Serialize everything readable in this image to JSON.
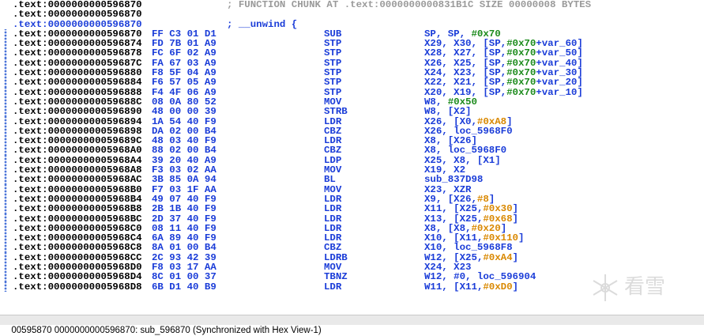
{
  "header_lines": [
    {
      "addr": ".text:0000000000596870",
      "comment": "; FUNCTION CHUNK AT .text:0000000000831B1C SIZE 00000008 BYTES"
    },
    {
      "addr": ".text:0000000000596870",
      "comment": ""
    },
    {
      "addr": ".text:0000000000596870",
      "keyword": "; __unwind {"
    }
  ],
  "code_lines": [
    {
      "addr": ".text:0000000000596870",
      "bytes": "FF C3 01 D1",
      "mnemonic": "SUB",
      "ops": [
        {
          "t": "SP, SP, "
        },
        {
          "t": "#0x70",
          "c": "grn"
        }
      ]
    },
    {
      "addr": ".text:0000000000596874",
      "bytes": "FD 7B 01 A9",
      "mnemonic": "STP",
      "ops": [
        {
          "t": "X29, X30, [SP,"
        },
        {
          "t": "#0x70",
          "c": "grn"
        },
        {
          "t": "+var_60]"
        }
      ]
    },
    {
      "addr": ".text:0000000000596878",
      "bytes": "FC 6F 02 A9",
      "mnemonic": "STP",
      "ops": [
        {
          "t": "X28, X27, [SP,"
        },
        {
          "t": "#0x70",
          "c": "grn"
        },
        {
          "t": "+var_50]"
        }
      ]
    },
    {
      "addr": ".text:000000000059687C",
      "bytes": "FA 67 03 A9",
      "mnemonic": "STP",
      "ops": [
        {
          "t": "X26, X25, [SP,"
        },
        {
          "t": "#0x70",
          "c": "grn"
        },
        {
          "t": "+var_40]"
        }
      ]
    },
    {
      "addr": ".text:0000000000596880",
      "bytes": "F8 5F 04 A9",
      "mnemonic": "STP",
      "ops": [
        {
          "t": "X24, X23, [SP,"
        },
        {
          "t": "#0x70",
          "c": "grn"
        },
        {
          "t": "+var_30]"
        }
      ]
    },
    {
      "addr": ".text:0000000000596884",
      "bytes": "F6 57 05 A9",
      "mnemonic": "STP",
      "ops": [
        {
          "t": "X22, X21, [SP,"
        },
        {
          "t": "#0x70",
          "c": "grn"
        },
        {
          "t": "+var_20]"
        }
      ]
    },
    {
      "addr": ".text:0000000000596888",
      "bytes": "F4 4F 06 A9",
      "mnemonic": "STP",
      "ops": [
        {
          "t": "X20, X19, [SP,"
        },
        {
          "t": "#0x70",
          "c": "grn"
        },
        {
          "t": "+var_10]"
        }
      ]
    },
    {
      "addr": ".text:000000000059688C",
      "bytes": "08 0A 80 52",
      "mnemonic": "MOV",
      "ops": [
        {
          "t": "W8, "
        },
        {
          "t": "#0x50",
          "c": "grn"
        }
      ]
    },
    {
      "addr": ".text:0000000000596890",
      "bytes": "48 00 00 39",
      "mnemonic": "STRB",
      "ops": [
        {
          "t": "W8, [X2]"
        }
      ]
    },
    {
      "addr": ".text:0000000000596894",
      "bytes": "1A 54 40 F9",
      "mnemonic": "LDR",
      "ops": [
        {
          "t": "X26, [X0,"
        },
        {
          "t": "#0xA8",
          "c": "org"
        },
        {
          "t": "]"
        }
      ]
    },
    {
      "addr": ".text:0000000000596898",
      "bytes": "DA 02 00 B4",
      "mnemonic": "CBZ",
      "ops": [
        {
          "t": "X26, loc_5968F0"
        }
      ]
    },
    {
      "addr": ".text:000000000059689C",
      "bytes": "48 03 40 F9",
      "mnemonic": "LDR",
      "ops": [
        {
          "t": "X8, [X26]"
        }
      ]
    },
    {
      "addr": ".text:00000000005968A0",
      "bytes": "88 02 00 B4",
      "mnemonic": "CBZ",
      "ops": [
        {
          "t": "X8, loc_5968F0"
        }
      ]
    },
    {
      "addr": ".text:00000000005968A4",
      "bytes": "39 20 40 A9",
      "mnemonic": "LDP",
      "ops": [
        {
          "t": "X25, X8, [X1]"
        }
      ]
    },
    {
      "addr": ".text:00000000005968A8",
      "bytes": "F3 03 02 AA",
      "mnemonic": "MOV",
      "ops": [
        {
          "t": "X19, X2"
        }
      ]
    },
    {
      "addr": ".text:00000000005968AC",
      "bytes": "3B 85 0A 94",
      "mnemonic": "BL",
      "ops": [
        {
          "t": "sub_837D98"
        }
      ]
    },
    {
      "addr": ".text:00000000005968B0",
      "bytes": "F7 03 1F AA",
      "mnemonic": "MOV",
      "ops": [
        {
          "t": "X23, XZR"
        }
      ]
    },
    {
      "addr": ".text:00000000005968B4",
      "bytes": "49 07 40 F9",
      "mnemonic": "LDR",
      "ops": [
        {
          "t": "X9, [X26,"
        },
        {
          "t": "#8",
          "c": "org"
        },
        {
          "t": "]"
        }
      ]
    },
    {
      "addr": ".text:00000000005968B8",
      "bytes": "2B 1B 40 F9",
      "mnemonic": "LDR",
      "ops": [
        {
          "t": "X11, [X25,"
        },
        {
          "t": "#0x30",
          "c": "org"
        },
        {
          "t": "]"
        }
      ]
    },
    {
      "addr": ".text:00000000005968BC",
      "bytes": "2D 37 40 F9",
      "mnemonic": "LDR",
      "ops": [
        {
          "t": "X13, [X25,"
        },
        {
          "t": "#0x68",
          "c": "org"
        },
        {
          "t": "]"
        }
      ]
    },
    {
      "addr": ".text:00000000005968C0",
      "bytes": "08 11 40 F9",
      "mnemonic": "LDR",
      "ops": [
        {
          "t": "X8, [X8,"
        },
        {
          "t": "#0x20",
          "c": "org"
        },
        {
          "t": "]"
        }
      ]
    },
    {
      "addr": ".text:00000000005968C4",
      "bytes": "6A 89 40 F9",
      "mnemonic": "LDR",
      "ops": [
        {
          "t": "X10, [X11,"
        },
        {
          "t": "#0x110",
          "c": "org"
        },
        {
          "t": "]"
        }
      ]
    },
    {
      "addr": ".text:00000000005968C8",
      "bytes": "8A 01 00 B4",
      "mnemonic": "CBZ",
      "ops": [
        {
          "t": "X10, loc_5968F8"
        }
      ]
    },
    {
      "addr": ".text:00000000005968CC",
      "bytes": "2C 93 42 39",
      "mnemonic": "LDRB",
      "ops": [
        {
          "t": "W12, [X25,"
        },
        {
          "t": "#0xA4",
          "c": "org"
        },
        {
          "t": "]"
        }
      ]
    },
    {
      "addr": ".text:00000000005968D0",
      "bytes": "F8 03 17 AA",
      "mnemonic": "MOV",
      "ops": [
        {
          "t": "X24, X23"
        }
      ]
    },
    {
      "addr": ".text:00000000005968D4",
      "bytes": "8C 01 00 37",
      "mnemonic": "TBNZ",
      "ops": [
        {
          "t": "W12, #0, loc_596904"
        }
      ]
    },
    {
      "addr": ".text:00000000005968D8",
      "bytes": "6B D1 40 B9",
      "mnemonic": "LDR",
      "ops": [
        {
          "t": "W11, [X11,"
        },
        {
          "t": "#0xD0",
          "c": "org"
        },
        {
          "t": "]"
        }
      ]
    }
  ],
  "status_bar": {
    "text": "00595870 0000000000596870: sub_596870 (Synchronized with Hex View-1)"
  },
  "watermark": {
    "text": "看雪"
  },
  "colors": {
    "address_blue": "#1a3cd8",
    "comment_gray": "#9a9a9a",
    "immediate_green": "#1a8a1a",
    "offset_orange": "#d98800"
  }
}
